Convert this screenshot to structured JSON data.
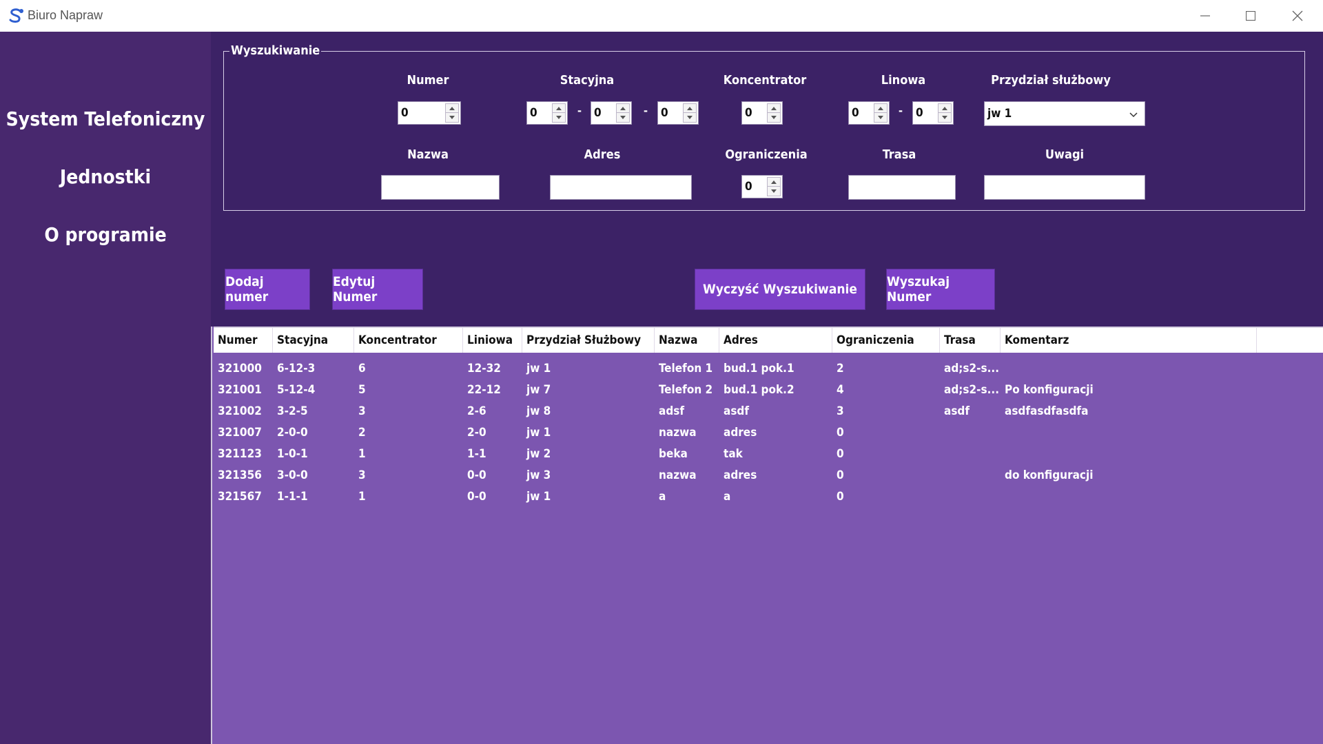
{
  "window": {
    "title": "Biuro Napraw"
  },
  "sidebar": {
    "items": [
      "System Telefoniczny",
      "Jednostki",
      "O programie"
    ]
  },
  "search": {
    "legend": "Wyszukiwanie",
    "labels": {
      "numer": "Numer",
      "stacyjna": "Stacyjna",
      "koncentrator": "Koncentrator",
      "linowa": "Linowa",
      "przydzial": "Przydział służbowy",
      "nazwa": "Nazwa",
      "adres": "Adres",
      "ograniczenia": "Ograniczenia",
      "trasa": "Trasa",
      "uwagi": "Uwagi"
    },
    "values": {
      "numer": "0",
      "stacyjna_1": "0",
      "stacyjna_2": "0",
      "stacyjna_3": "0",
      "koncentrator": "0",
      "linowa_1": "0",
      "linowa_2": "0",
      "przydzial": "jw 1",
      "nazwa": "",
      "adres": "",
      "ograniczenia": "0",
      "trasa": "",
      "uwagi": ""
    },
    "separator": "-"
  },
  "buttons": {
    "add": "Dodaj numer",
    "edit": "Edytuj Numer",
    "clear": "Wyczyść Wyszukiwanie",
    "search": "Wyszukaj Numer"
  },
  "table": {
    "columns": [
      "Numer",
      "Stacyjna",
      "Koncentrator",
      "Liniowa",
      "Przydział Służbowy",
      "Nazwa",
      "Adres",
      "Ograniczenia",
      "Trasa",
      "Komentarz"
    ],
    "rows": [
      [
        "321000",
        "6-12-3",
        "6",
        "12-32",
        "jw 1",
        "Telefon 1",
        "bud.1 pok.1",
        "2",
        "ad;s2-s...",
        ""
      ],
      [
        "321001",
        "5-12-4",
        "5",
        "22-12",
        "jw 7",
        "Telefon 2",
        "bud.1 pok.2",
        "4",
        "ad;s2-s...",
        "Po konfiguracji"
      ],
      [
        "321002",
        "3-2-5",
        "3",
        "2-6",
        "jw 8",
        "adsf",
        "asdf",
        "3",
        "asdf",
        "asdfasdfasdfa"
      ],
      [
        "321007",
        "2-0-0",
        "2",
        "2-0",
        "jw 1",
        "nazwa",
        "adres",
        "0",
        "",
        ""
      ],
      [
        "321123",
        "1-0-1",
        "1",
        "1-1",
        "jw 2",
        "beka",
        "tak",
        "0",
        "",
        ""
      ],
      [
        "321356",
        "3-0-0",
        "3",
        "0-0",
        "jw 3",
        "nazwa",
        "adres",
        "0",
        "",
        "do konfiguracji"
      ],
      [
        "321567",
        "1-1-1",
        "1",
        "0-0",
        "jw 1",
        "a",
        "a",
        "0",
        "",
        ""
      ]
    ]
  },
  "colors": {
    "sidebar": "#48286e",
    "main": "#3c2266",
    "button": "#7c40c8",
    "grid_body": "#7c56b0"
  },
  "icons": [
    "app-logo-icon",
    "minimize-icon",
    "maximize-icon",
    "close-icon",
    "chevron-down-icon",
    "spin-up-icon",
    "spin-down-icon"
  ]
}
